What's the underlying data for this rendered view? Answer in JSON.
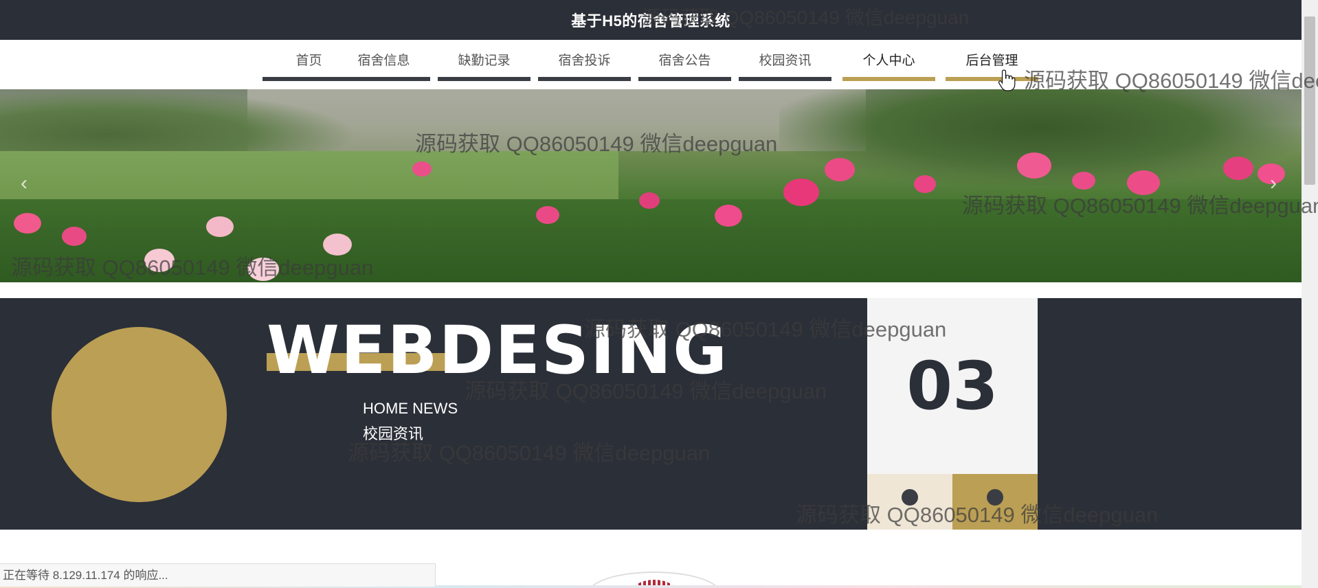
{
  "header": {
    "title": "基于H5的宿舍管理系统"
  },
  "nav": {
    "items": [
      {
        "label": "首页",
        "active": false
      },
      {
        "label": "宿舍信息",
        "active": false
      },
      {
        "label": "缺勤记录",
        "active": false
      },
      {
        "label": "宿舍投诉",
        "active": false
      },
      {
        "label": "宿舍公告",
        "active": false
      },
      {
        "label": "校园资讯",
        "active": false
      },
      {
        "label": "个人中心",
        "active": true
      },
      {
        "label": "后台管理",
        "active": true
      }
    ]
  },
  "banner": {
    "prev_icon": "chevron-left-icon",
    "next_icon": "chevron-right-icon",
    "prev_glyph": "‹",
    "next_glyph": "›"
  },
  "feature": {
    "big_word": "WEBDESING",
    "sub_en": "HOME NEWS",
    "sub_cn": "校园资讯",
    "number": "03"
  },
  "status_bar": {
    "text": "正在等待 8.129.11.174 的响应..."
  },
  "watermark": {
    "text": "源码获取 QQ86050149 微信deepguan"
  },
  "colors": {
    "dark": "#2b2f38",
    "gold": "#bb9f54",
    "light_box": "#f4f4f4"
  }
}
